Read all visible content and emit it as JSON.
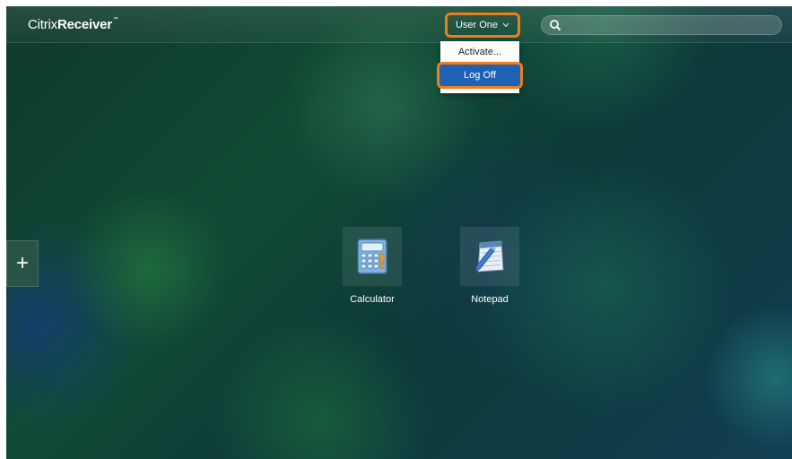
{
  "header": {
    "logo_light": "Citrix",
    "logo_bold": "Receiver",
    "logo_tm": "™",
    "user_name": "User One",
    "search_placeholder": ""
  },
  "user_menu": {
    "items": [
      {
        "label": "Activate..."
      },
      {
        "label": "Log Off",
        "highlighted": true
      }
    ]
  },
  "sidebar": {
    "add_label": "+"
  },
  "apps": [
    {
      "name": "Calculator",
      "icon": "calculator-icon"
    },
    {
      "name": "Notepad",
      "icon": "notepad-icon"
    }
  ],
  "colors": {
    "highlight_outline": "#f07c1a",
    "menu_selected": "#1e62b4"
  }
}
